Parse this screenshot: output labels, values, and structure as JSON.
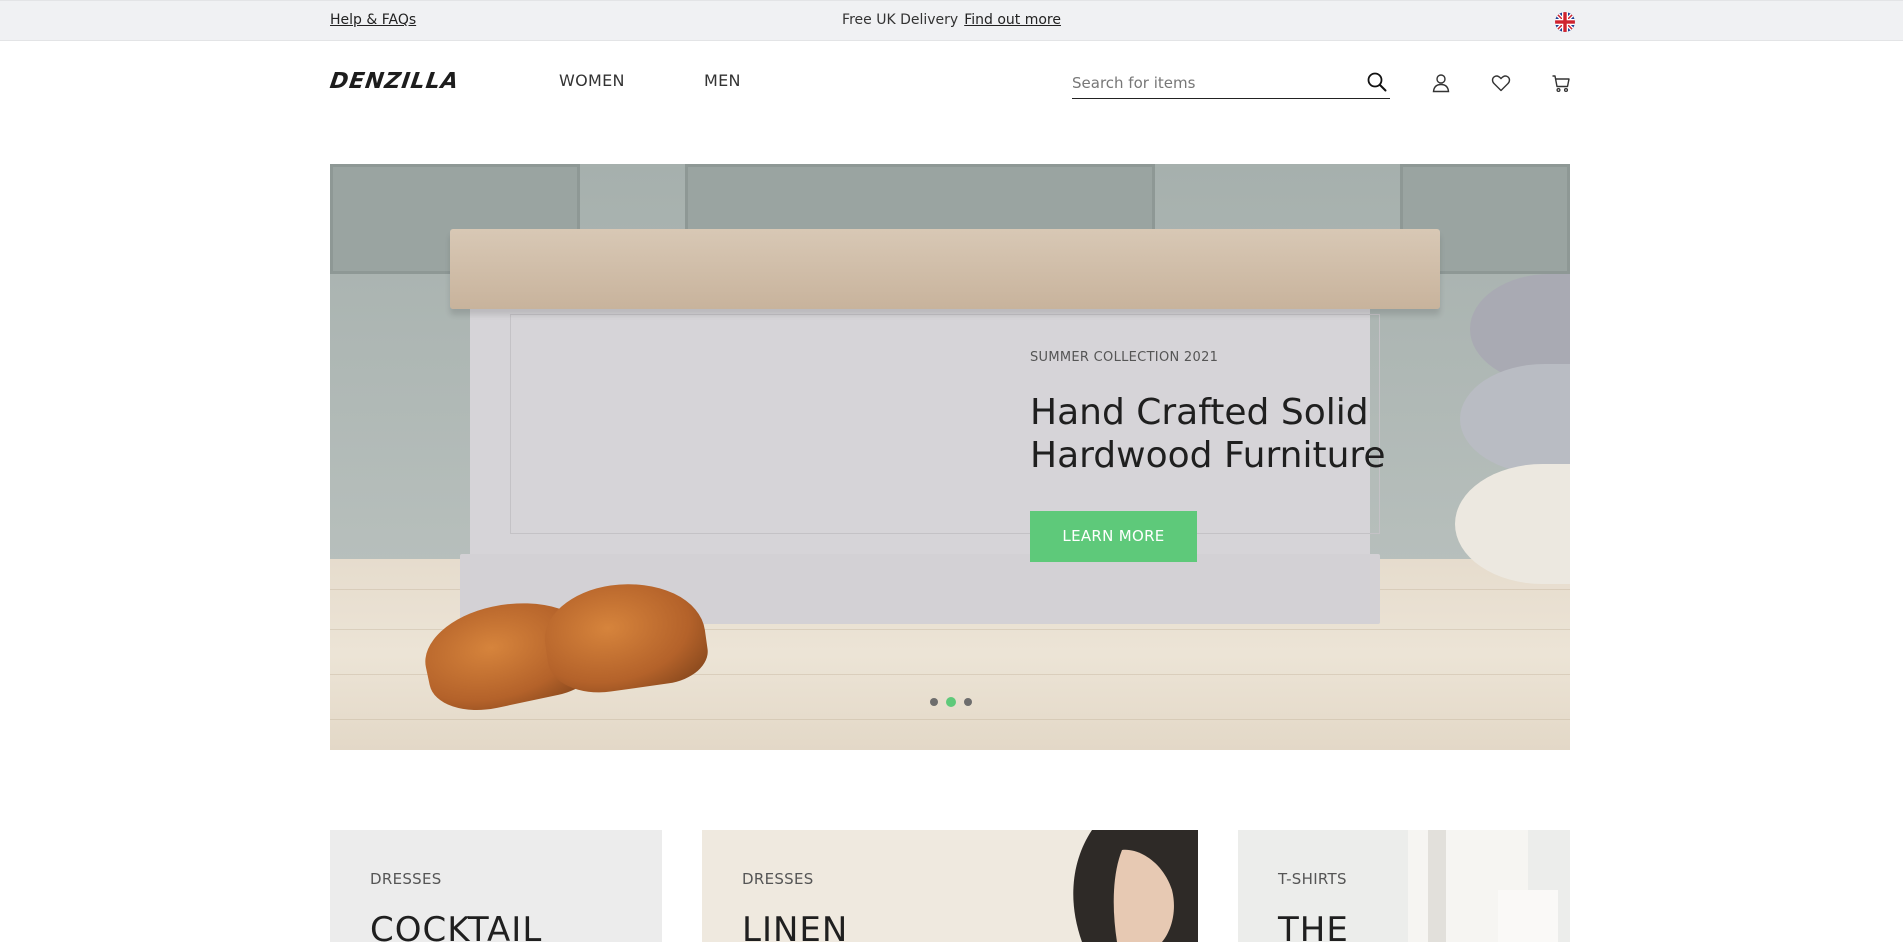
{
  "topbar": {
    "help_label": "Help & FAQs",
    "promo_text": "Free UK Delivery",
    "promo_link": "Find out more",
    "region_icon": "uk-flag-icon"
  },
  "header": {
    "logo_text": "DENZILLA",
    "nav": [
      {
        "label": "WOMEN"
      },
      {
        "label": "MEN"
      }
    ],
    "search": {
      "placeholder": "Search for items",
      "value": ""
    },
    "icons": [
      "search-icon",
      "user-icon",
      "heart-icon",
      "cart-icon"
    ]
  },
  "hero": {
    "eyebrow": "SUMMER COLLECTION 2021",
    "title_line1": "Hand Crafted Solid",
    "title_line2": "Hardwood Furniture",
    "cta_label": "LEARN MORE",
    "slide_count": 3,
    "active_slide": 2,
    "accent_color": "#5ec97a"
  },
  "categories": [
    {
      "eyebrow": "DRESSES",
      "title": "COCKTAIL"
    },
    {
      "eyebrow": "DRESSES",
      "title": "LINEN"
    },
    {
      "eyebrow": "T-SHIRTS",
      "title": "THE"
    }
  ]
}
